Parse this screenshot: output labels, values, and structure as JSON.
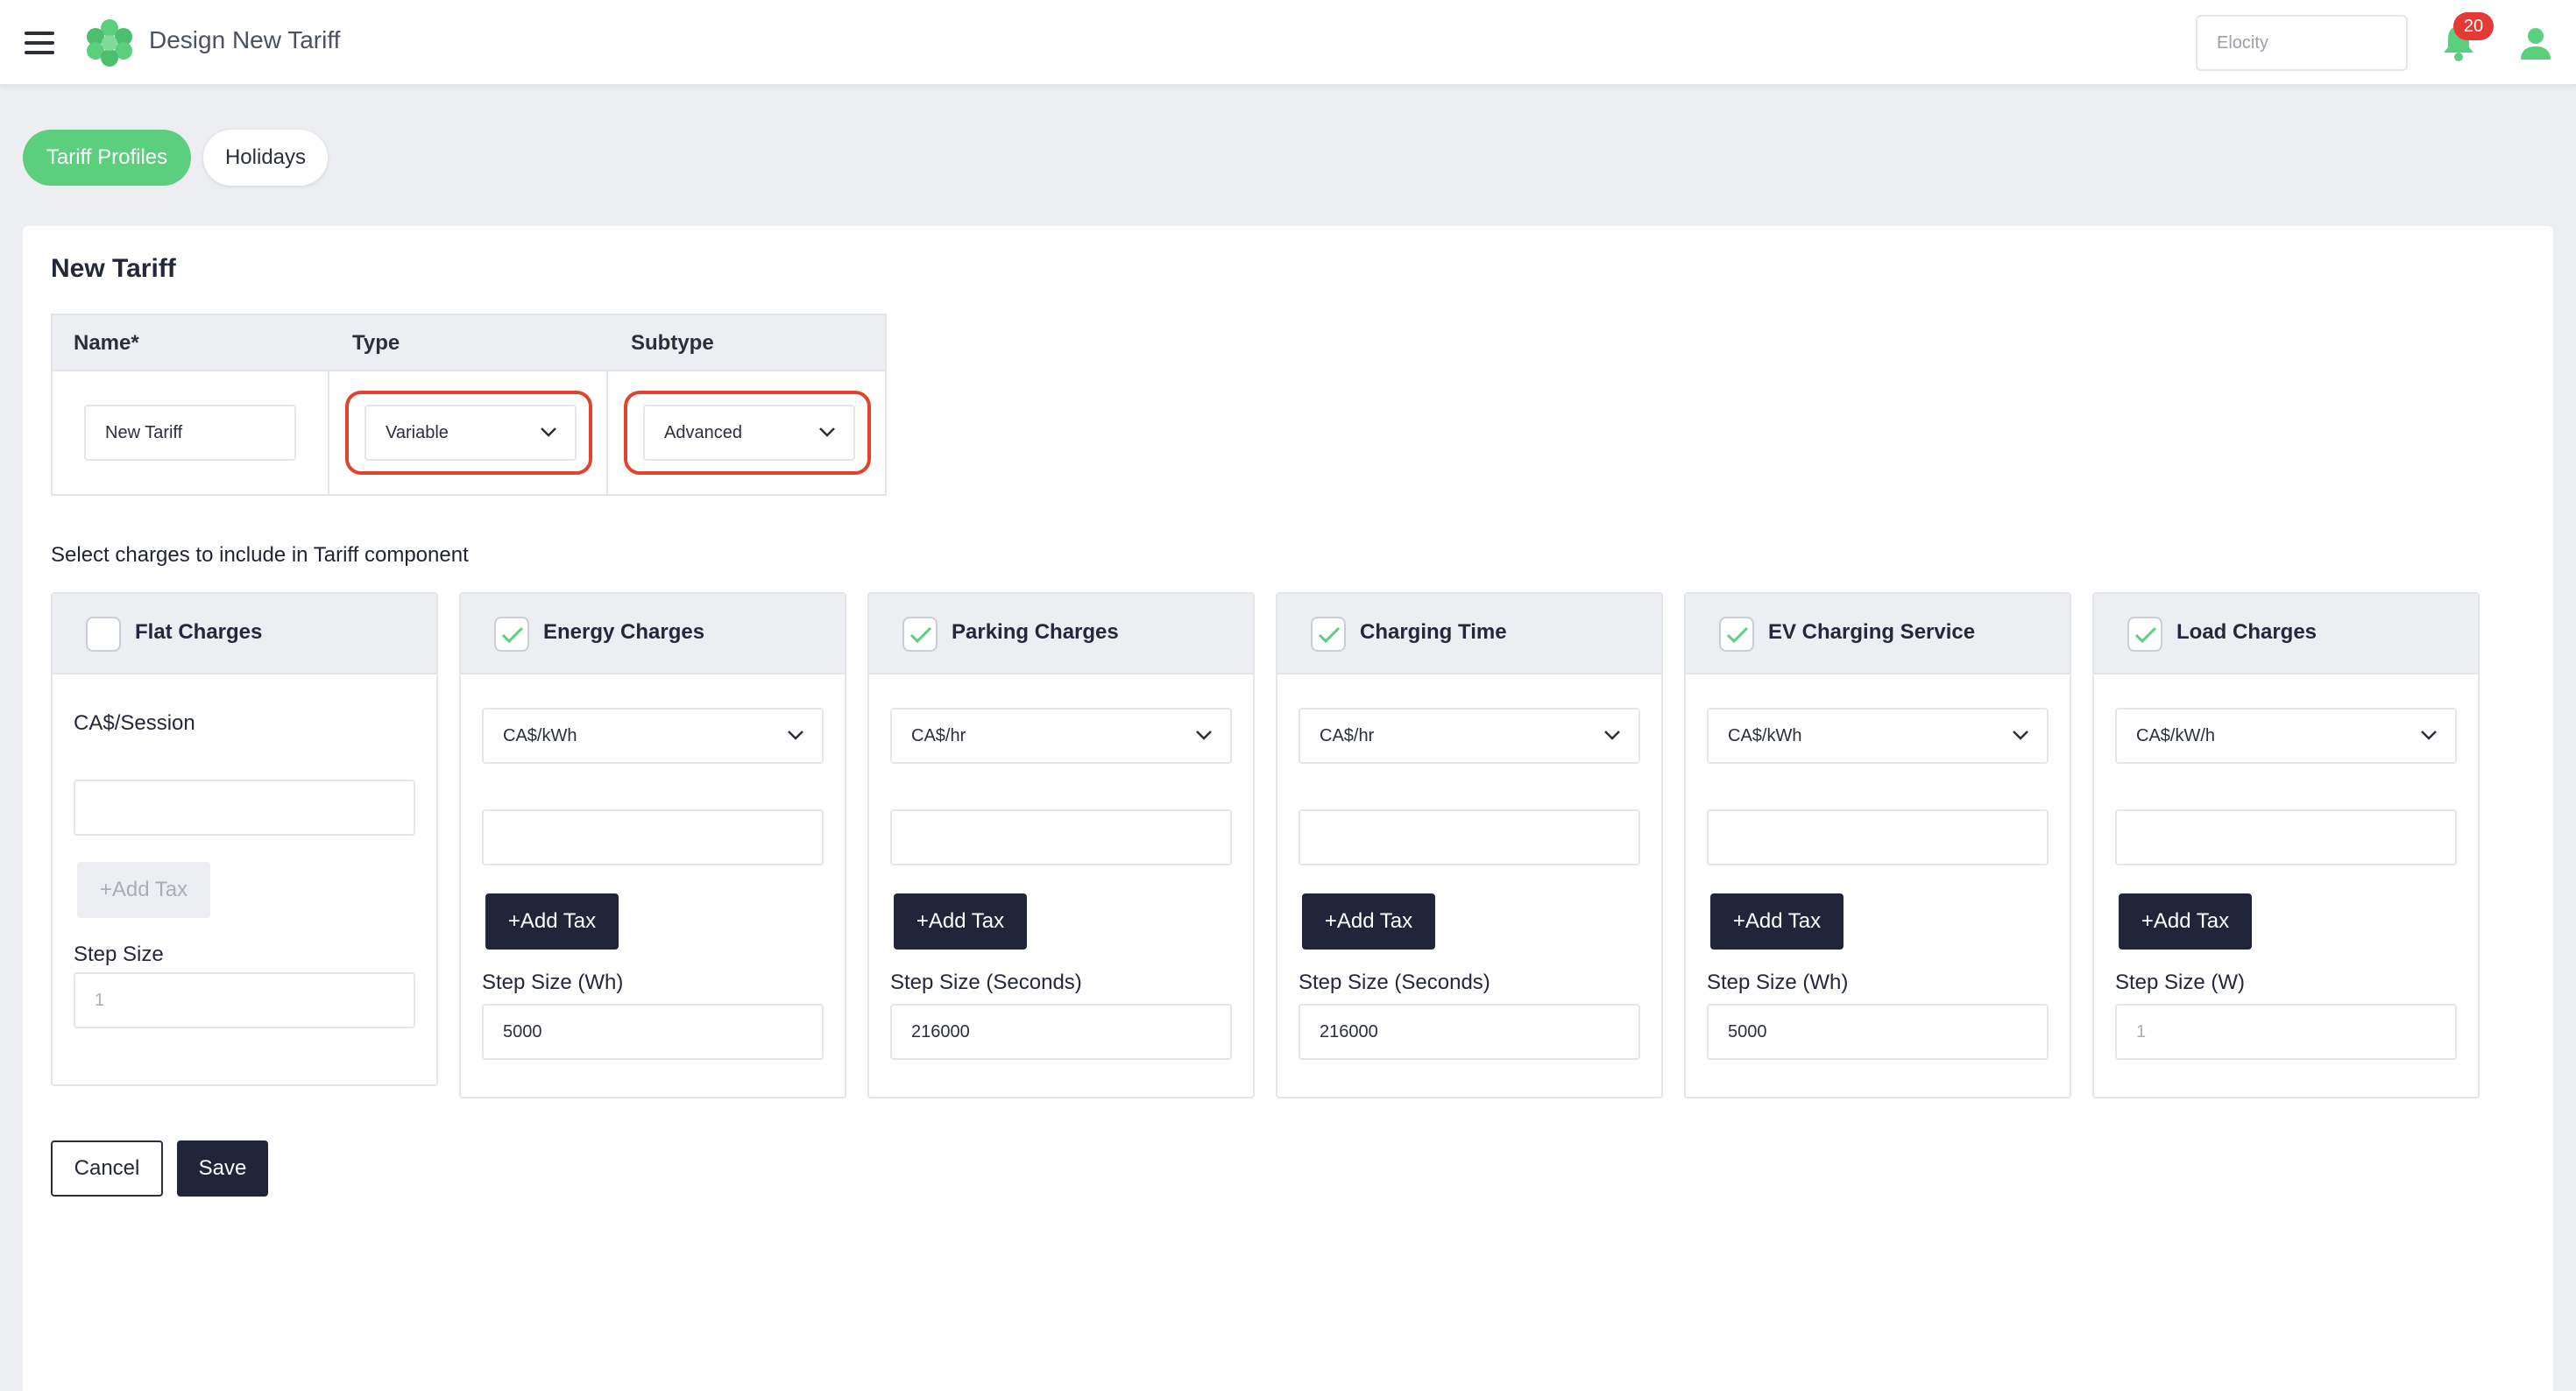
{
  "header": {
    "title": "Design New Tariff",
    "org_placeholder": "Elocity",
    "notification_count": "20",
    "menu_icon": "hamburger-menu-icon",
    "logo_icon": "flower-logo-icon",
    "bell_icon": "bell-icon",
    "user_icon": "user-icon",
    "brand_color": "#5ccf7e"
  },
  "tabs": [
    {
      "label": "Tariff Profiles",
      "active": true
    },
    {
      "label": "Holidays",
      "active": false
    }
  ],
  "form": {
    "title": "New Tariff",
    "columns": {
      "name": "Name*",
      "type": "Type",
      "subtype": "Subtype"
    },
    "name_value": "New Tariff",
    "type_value": "Variable",
    "subtype_value": "Advanced",
    "highlight_color": "#e0442e"
  },
  "charges_instruction": "Select charges to include in Tariff component",
  "charges": [
    {
      "title": "Flat Charges",
      "checked": false,
      "unit": "CA$/Session",
      "add_tax": "+Add Tax",
      "step_label": "Step Size",
      "step_value": "1",
      "step_is_placeholder": true
    },
    {
      "title": "Energy Charges",
      "checked": true,
      "unit": "CA$/kWh",
      "add_tax": "+Add Tax",
      "step_label": "Step Size (Wh)",
      "step_value": "5000"
    },
    {
      "title": "Parking Charges",
      "checked": true,
      "unit": "CA$/hr",
      "add_tax": "+Add Tax",
      "step_label": "Step Size (Seconds)",
      "step_value": "216000"
    },
    {
      "title": "Charging Time",
      "checked": true,
      "unit": "CA$/hr",
      "add_tax": "+Add Tax",
      "step_label": "Step Size (Seconds)",
      "step_value": "216000"
    },
    {
      "title": "EV Charging Service",
      "checked": true,
      "unit": "CA$/kWh",
      "add_tax": "+Add Tax",
      "step_label": "Step Size (Wh)",
      "step_value": "5000"
    },
    {
      "title": "Load Charges",
      "checked": true,
      "unit": "CA$/kW/h",
      "add_tax": "+Add Tax",
      "step_label": "Step Size (W)",
      "step_value": "1",
      "step_is_placeholder": true
    }
  ],
  "actions": {
    "cancel": "Cancel",
    "save": "Save"
  }
}
